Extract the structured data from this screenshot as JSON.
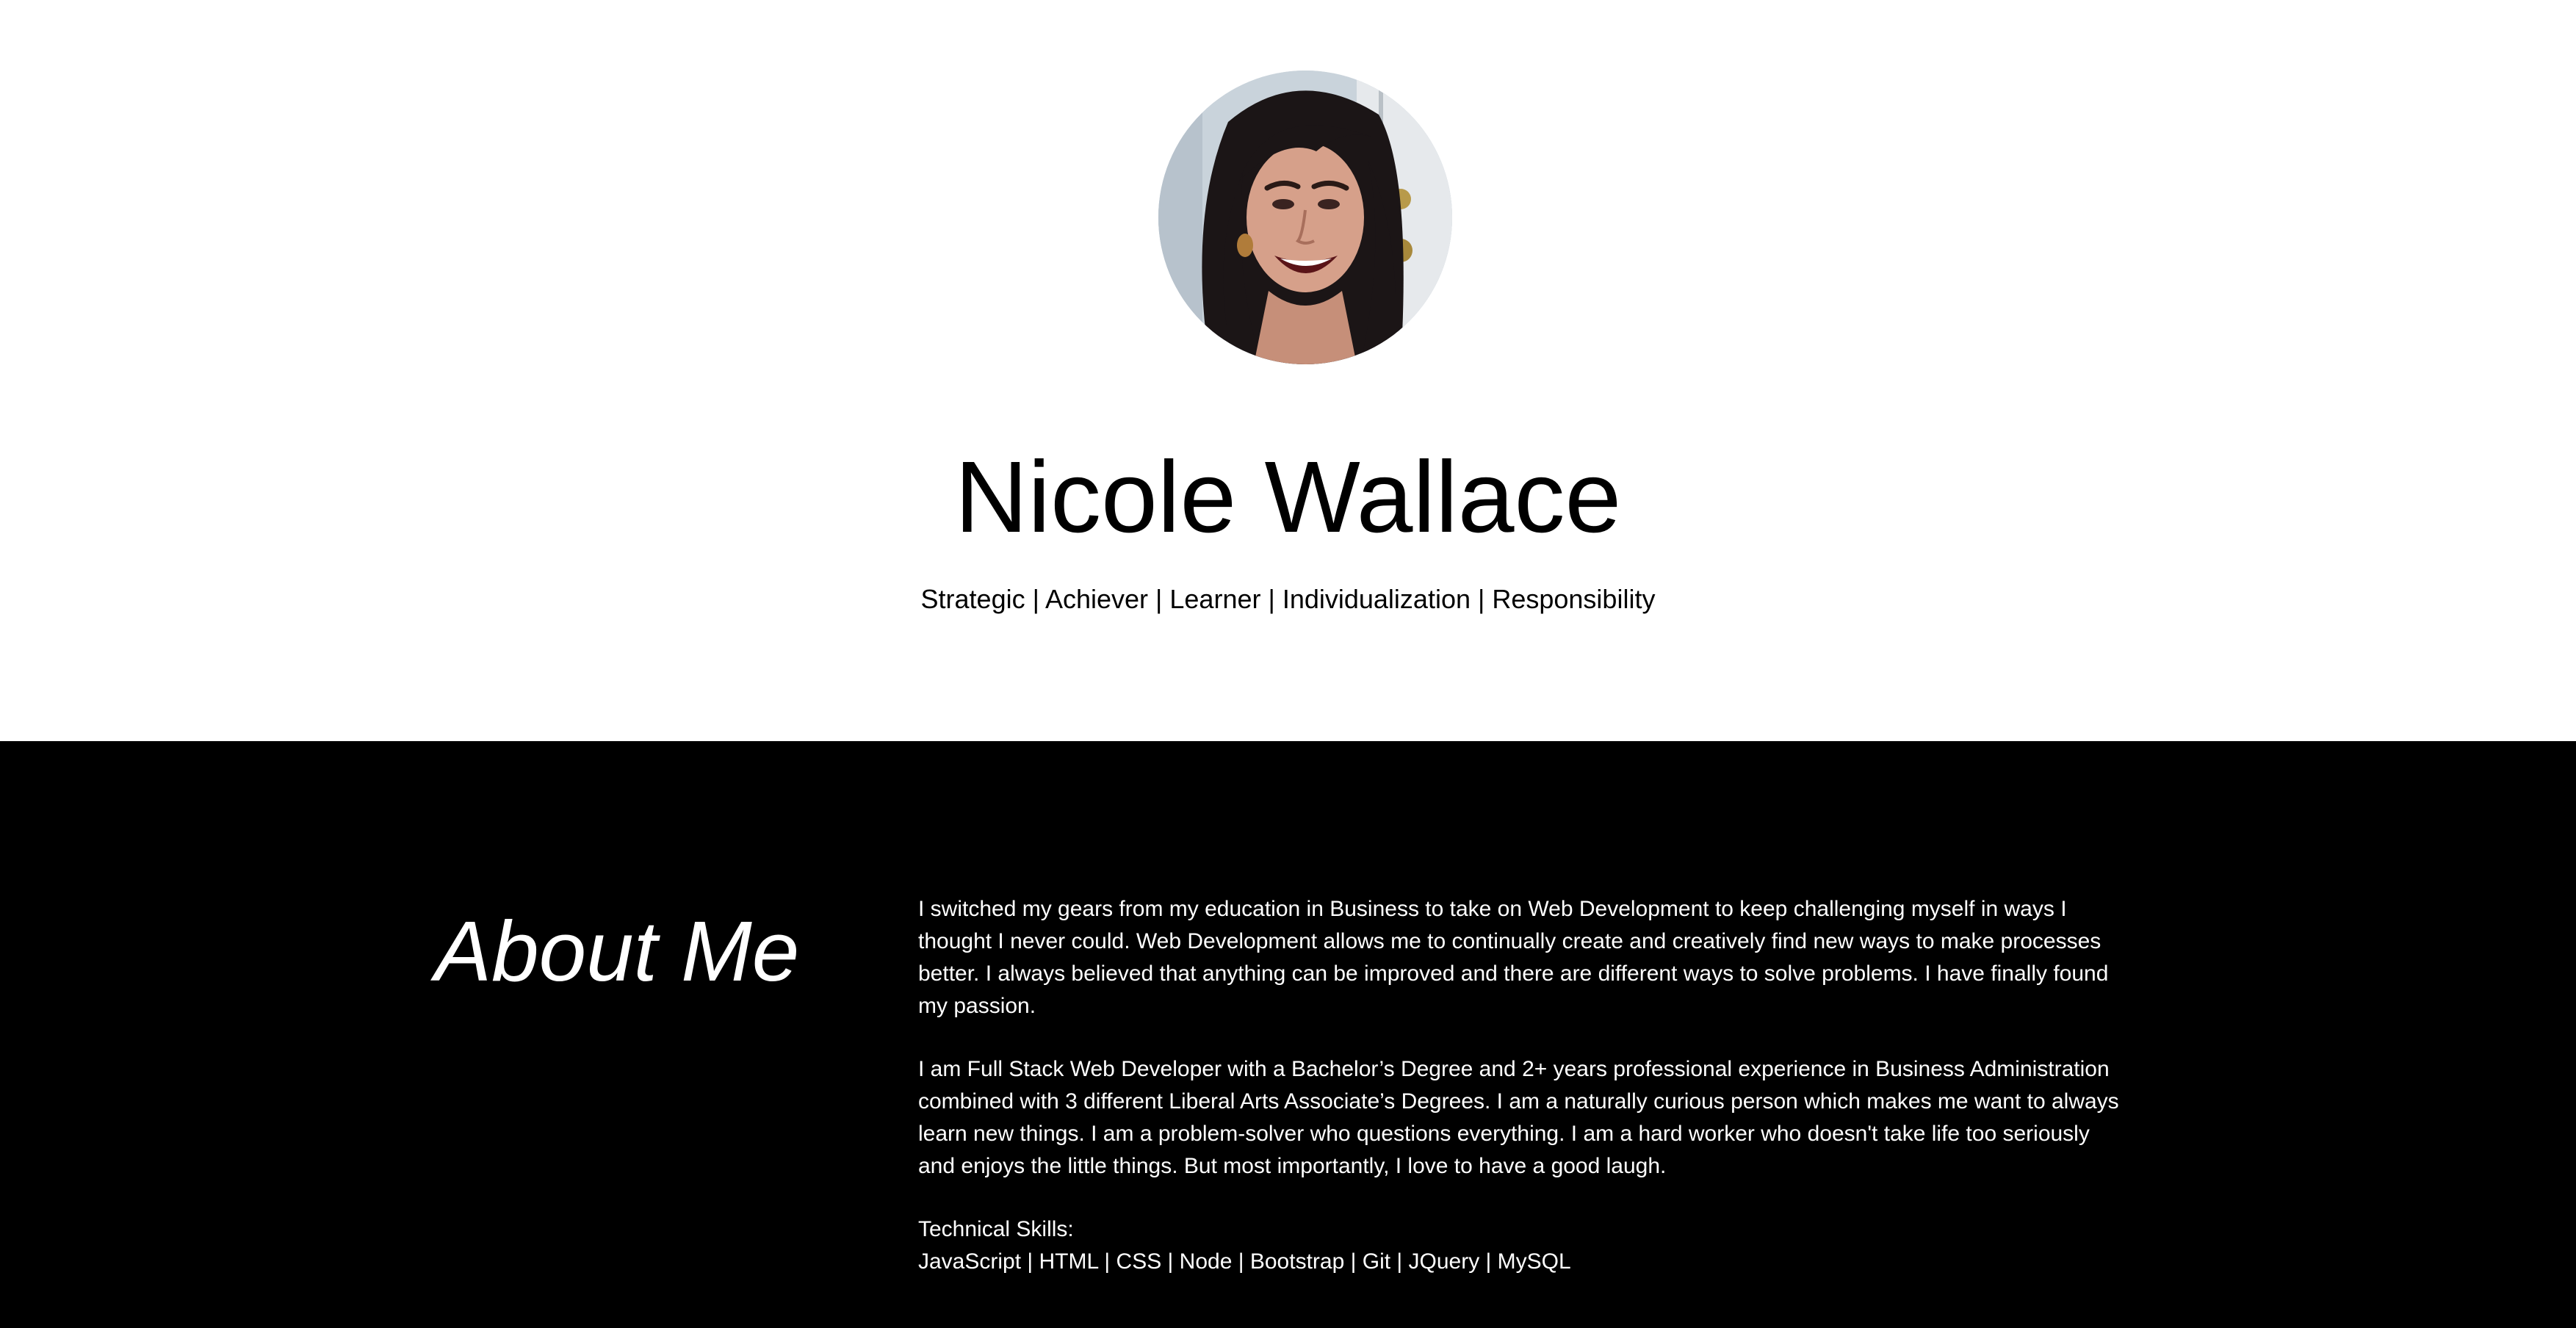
{
  "profile": {
    "name": "Nicole Wallace",
    "strengths": "Strategic | Achiever | Learner | Individualization | Responsibility",
    "avatar_icon": "profile-photo"
  },
  "about": {
    "title": "About Me",
    "paragraph_1": "I switched my gears from my education in Business to take on Web Development to keep challenging myself in ways I thought I never could. Web Development allows me to continually create and creatively find new ways to make processes better. I always believed that anything can be improved and there are different ways to solve problems. I have finally found my passion.",
    "paragraph_2": "I am Full Stack Web Developer with a Bachelor’s Degree and 2+ years professional experience in Business Administration combined with 3 different Liberal Arts Associate’s Degrees. I am a naturally curious person which makes me want to always learn new things. I am a problem-solver who questions everything. I am a hard worker who doesn't take life too seriously and enjoys the little things. But most importantly, I love to have a good laugh.",
    "skills_label": "Technical Skills:",
    "skills_list": "JavaScript | HTML | CSS | Node | Bootstrap | Git | JQuery | MySQL"
  },
  "colors": {
    "hero_background": "#ffffff",
    "about_background": "#000000",
    "hero_text": "#000000",
    "about_text": "#ffffff"
  }
}
